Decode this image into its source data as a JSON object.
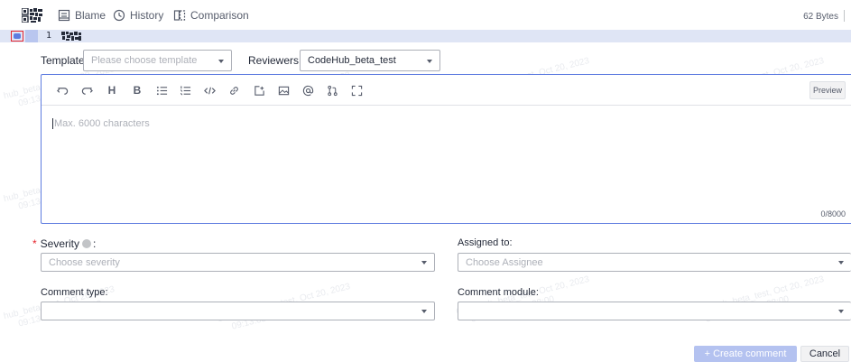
{
  "header": {
    "blame_label": "Blame",
    "history_label": "History",
    "comparison_label": "Comparison",
    "file_size": "62 Bytes"
  },
  "code": {
    "line_number": "1"
  },
  "review": {
    "template_label": "Template",
    "template_placeholder": "Please choose template",
    "reviewers_label": "Reviewers",
    "reviewers_value": "CodeHub_beta_test"
  },
  "editor": {
    "preview_label": "Preview",
    "placeholder": "Max. 6000 characters",
    "char_count": "0/8000",
    "tools": [
      "undo-icon",
      "redo-icon",
      "heading-icon",
      "bold-icon",
      "bullet-list-icon",
      "numbered-list-icon",
      "code-icon",
      "link-icon",
      "insert-icon",
      "image-icon",
      "mention-icon",
      "merge-request-icon",
      "fullscreen-icon"
    ]
  },
  "fields": {
    "severity_label": "Severity",
    "severity_placeholder": "Choose severity",
    "assigned_label": "Assigned to:",
    "assigned_placeholder": "Choose Assignee",
    "comment_type_label": "Comment type:",
    "comment_module_label": "Comment module:"
  },
  "actions": {
    "create_label": "+ Create comment",
    "cancel_label": "Cancel"
  },
  "colors": {
    "accent": "#5e7ce0",
    "create_disabled": "#b4c2f0",
    "required": "#e6262e",
    "line_highlight": "#dfe5f5"
  }
}
